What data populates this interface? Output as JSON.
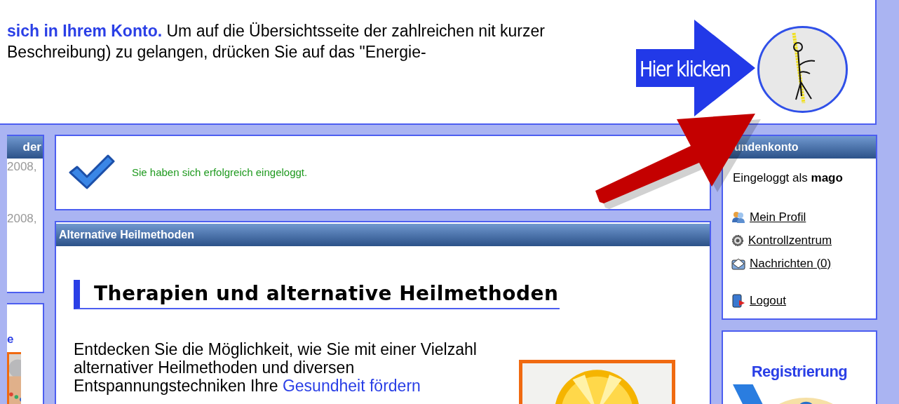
{
  "intro": {
    "text": "**sich in Ihrem Konto.** Um auf die Übersichtsseite der zahlreichen nit kurzer Beschreibung) zu gelangen, drücken Sie auf das \"Energie-"
  },
  "callout": {
    "text": "Hier klicken"
  },
  "left_column": {
    "header": "der",
    "entries": [
      "2008,",
      "2008,"
    ],
    "link": "e"
  },
  "success": {
    "message": "Sie haben sich erfolgreich eingeloggt."
  },
  "main": {
    "header": "Alternative Heilmethoden",
    "heading": "Therapien und alternative Heilmethoden",
    "paragraph": "Entdecken Sie die Möglichkeit, wie Sie mit einer Vielzahl alternativer Heilmethoden und diversen Entspannungstechniken Ihre ",
    "link": "Gesundheit fördern"
  },
  "account": {
    "header": "undenkonto",
    "status": "Eingeloggt als **mago**",
    "links": [
      {
        "kind": "profile",
        "label": "Mein Profil"
      },
      {
        "kind": "settings",
        "label": "Kontrollzentrum"
      },
      {
        "kind": "messages",
        "label": "Nachrichten (0)"
      },
      {
        "kind": "logout",
        "label": "Logout"
      }
    ]
  },
  "register": {
    "title": "Registrierung"
  }
}
